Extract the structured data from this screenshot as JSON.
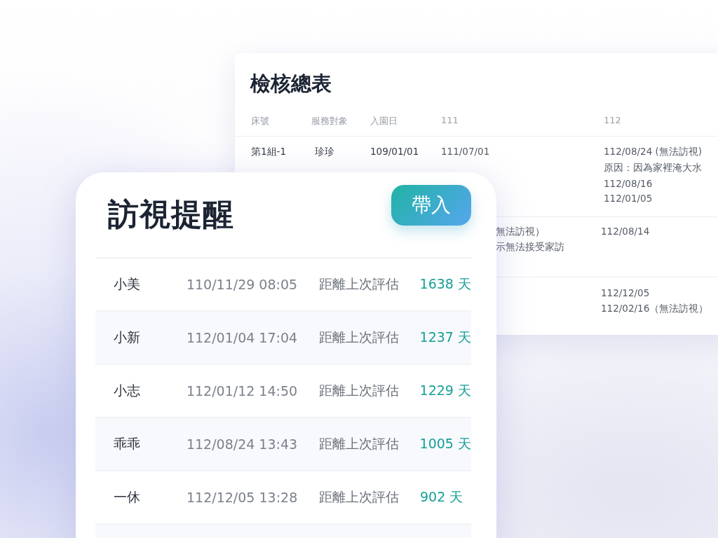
{
  "summary_table": {
    "title": "檢核總表",
    "columns": [
      "床號",
      "服務對象",
      "入園日",
      "111",
      "112"
    ],
    "rows": [
      {
        "bed": "第1組-1",
        "client": "珍珍",
        "admission": "109/01/01",
        "col_111": [
          "111/07/01"
        ],
        "col_112": [
          "112/08/24 (無法訪視)",
          "原因：因為家裡淹大水",
          "112/08/16",
          "112/01/05"
        ]
      },
      {
        "col_111": [
          "無法訪視）",
          "示無法接受家訪"
        ],
        "col_112": [
          "112/08/14"
        ]
      },
      {
        "col_112": [
          "112/12/05",
          "112/02/16（無法訪視）"
        ]
      }
    ]
  },
  "visit_reminder": {
    "title": "訪視提醒",
    "button": "帶入",
    "items": [
      {
        "name": "小美",
        "time": "110/11/29 08:05",
        "label": "距離上次評估",
        "days": "1638 天"
      },
      {
        "name": "小新",
        "time": "112/01/04 17:04",
        "label": "距離上次評估",
        "days": "1237 天"
      },
      {
        "name": "小志",
        "time": "112/01/12 14:50",
        "label": "距離上次評估",
        "days": "1229 天"
      },
      {
        "name": "乖乖",
        "time": "112/08/24 13:43",
        "label": "距離上次評估",
        "days": "1005 天"
      },
      {
        "name": "一休",
        "time": "112/12/05 13:28",
        "label": "距離上次評估",
        "days": "902 天"
      }
    ]
  }
}
